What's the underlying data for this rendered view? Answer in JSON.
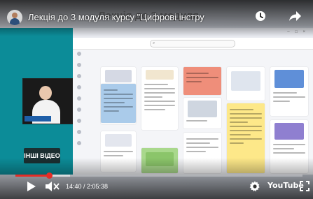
{
  "player": {
    "title": "Лекція до 3 модуля курсу \"Цифрові інстру",
    "background_title": "Лекція до 3 модуля",
    "more_videos_label": "ІНШІ ВІДЕО",
    "time_display": "14:40 / 2:05:38",
    "youtube_label": "YouTube",
    "progress_played": 0.117,
    "progress_loaded": 0.19,
    "accent_color": "#e52d27",
    "panel_color": "#0c8c98"
  },
  "icons": {
    "watch_later": "clock-icon",
    "share": "share-arrow-icon",
    "play": "play-icon",
    "mute": "muted-speaker-icon",
    "settings": "gear-icon",
    "fullscreen": "fullscreen-icon"
  }
}
